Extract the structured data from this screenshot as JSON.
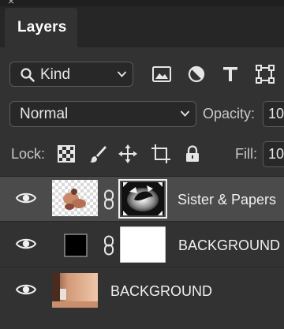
{
  "panel": {
    "close_glyph": "×",
    "tab_label": "Layers"
  },
  "filter": {
    "kind_label": "Kind",
    "icons": [
      "search-icon",
      "image-filter-icon",
      "adjustment-filter-icon",
      "type-filter-icon",
      "shape-filter-icon"
    ]
  },
  "blend": {
    "mode": "Normal",
    "opacity_label": "Opacity:",
    "opacity_value": "10"
  },
  "lock": {
    "label": "Lock:",
    "icons": [
      "lock-transparent-pixels-icon",
      "lock-image-pixels-icon",
      "lock-position-icon",
      "lock-artboard-icon",
      "lock-all-icon"
    ],
    "fill_label": "Fill:",
    "fill_value": "10"
  },
  "layers": [
    {
      "name": "Sister & Papers",
      "visible": true,
      "selected": true,
      "has_mask": true
    },
    {
      "name": "BACKGROUND",
      "visible": true,
      "selected": false,
      "fill_color": "#000000",
      "has_mask": true
    },
    {
      "name": "BACKGROUND",
      "visible": true,
      "selected": false,
      "has_mask": false
    }
  ],
  "colors": {
    "panel_bg": "#323232",
    "selected_row": "#4b4b4b",
    "tab_bg": "#262626",
    "text": "#e6e6e6"
  }
}
